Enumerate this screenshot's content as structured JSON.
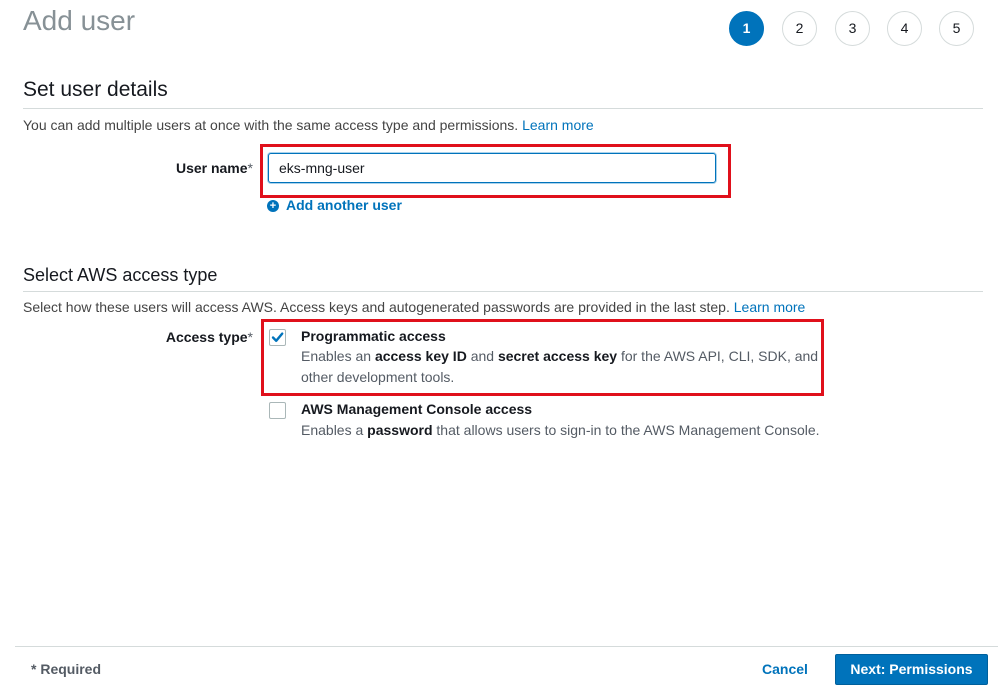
{
  "header": {
    "title": "Add user",
    "steps": [
      "1",
      "2",
      "3",
      "4",
      "5"
    ],
    "active_step": "1"
  },
  "user_details": {
    "title": "Set user details",
    "help_text": "You can add multiple users at once with the same access type and permissions.",
    "help_link": "Learn more",
    "user_name_label": "User name",
    "required_mark": "*",
    "user_name_value": "eks-mng-user",
    "add_another_label": "Add another user"
  },
  "access_type": {
    "title": "Select AWS access type",
    "help_text": "Select how these users will access AWS. Access keys and autogenerated passwords are provided in the last step.",
    "help_link": "Learn more",
    "label": "Access type",
    "required_mark": "*",
    "options": [
      {
        "title": "Programmatic access",
        "checked": true,
        "desc_parts": [
          "Enables an ",
          "access key ID",
          " and ",
          "secret access key",
          " for the AWS API, CLI, SDK, and other development tools."
        ]
      },
      {
        "title": "AWS Management Console access",
        "checked": false,
        "desc_parts": [
          "Enables a ",
          "password",
          " that allows users to sign-in to the AWS Management Console."
        ]
      }
    ]
  },
  "footer": {
    "required_note": "* Required",
    "cancel_label": "Cancel",
    "next_label": "Next: Permissions"
  },
  "colors": {
    "accent": "#0073bb",
    "highlight": "#e0101b"
  }
}
